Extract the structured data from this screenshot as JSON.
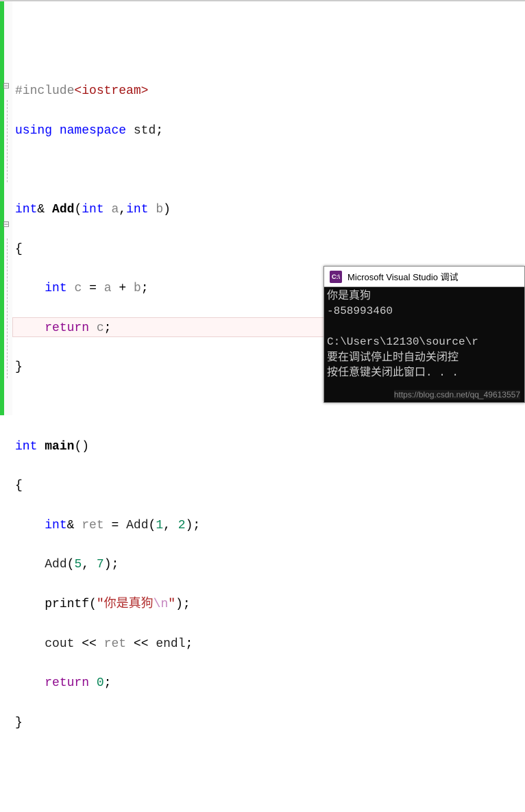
{
  "code": {
    "include_dir": "#include",
    "include_name": "<iostream>",
    "using": "using",
    "namespace": "namespace",
    "std": "std",
    "semi": ";",
    "int": "int",
    "amp": "&",
    "func_add": "Add",
    "lparen": "(",
    "rparen": ")",
    "param_a": "a",
    "param_b": "b",
    "comma": ",",
    "lbrace": "{",
    "rbrace": "}",
    "var_c": "c",
    "eq": "=",
    "plus": "+",
    "return": "return",
    "func_main": "main",
    "var_ret": "ret",
    "call_add_1": "1",
    "call_add_2": "2",
    "call_add_5": "5",
    "call_add_7": "7",
    "printf": "printf",
    "str_open": "\"",
    "str_cn": "你是真狗",
    "str_esc": "\\n",
    "str_close": "\"",
    "cout": "cout",
    "lshift": "<<",
    "endl": "endl",
    "zero": "0"
  },
  "console": {
    "title": "Microsoft Visual Studio 调试",
    "icon_text": "C:\\",
    "line1": "你是真狗",
    "line2": "-858993460",
    "line3": "",
    "line4": "C:\\Users\\12130\\source\\r",
    "line5": "要在调试停止时自动关闭控",
    "line6": "按任意键关闭此窗口. . .",
    "watermark": "https://blog.csdn.net/qq_49613557"
  }
}
